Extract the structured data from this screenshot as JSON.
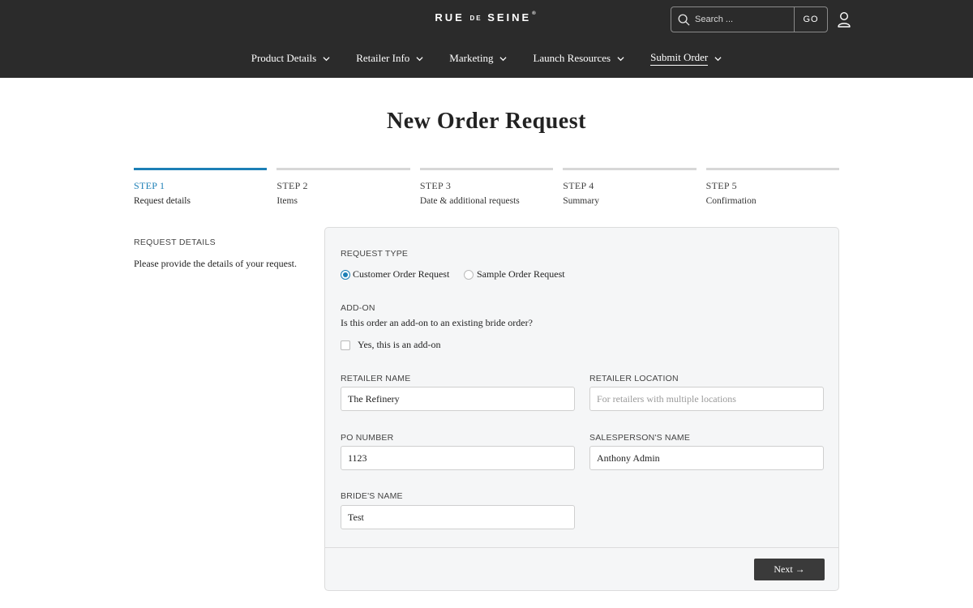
{
  "header": {
    "logo_part1": "RUE",
    "logo_part2": "DE",
    "logo_part3": "SEINE",
    "logo_mark": "®",
    "search_placeholder": "Search ...",
    "search_button": "GO"
  },
  "nav": {
    "items": [
      {
        "label": "Product Details"
      },
      {
        "label": "Retailer Info"
      },
      {
        "label": "Marketing"
      },
      {
        "label": "Launch Resources"
      },
      {
        "label": "Submit Order"
      }
    ]
  },
  "page": {
    "title": "New Order Request"
  },
  "steps": [
    {
      "num": "STEP 1",
      "desc": "Request details",
      "active": true
    },
    {
      "num": "STEP 2",
      "desc": "Items",
      "active": false
    },
    {
      "num": "STEP 3",
      "desc": "Date & additional requests",
      "active": false
    },
    {
      "num": "STEP 4",
      "desc": "Summary",
      "active": false
    },
    {
      "num": "STEP 5",
      "desc": "Confirmation",
      "active": false
    }
  ],
  "side": {
    "heading": "REQUEST DETAILS",
    "text": "Please provide the details of your request."
  },
  "form": {
    "request_type": {
      "label": "REQUEST TYPE",
      "options": [
        "Customer Order Request",
        "Sample Order Request"
      ],
      "selected": "Customer Order Request"
    },
    "addon": {
      "label": "ADD-ON",
      "question": "Is this order an add-on to an existing bride order?",
      "checkbox_label": "Yes, this is an add-on",
      "checked": false
    },
    "retailer_name": {
      "label": "RETAILER NAME",
      "value": "The Refinery"
    },
    "retailer_location": {
      "label": "RETAILER LOCATION",
      "value": "",
      "placeholder": "For retailers with multiple locations"
    },
    "po_number": {
      "label": "PO NUMBER",
      "value": "1123"
    },
    "salesperson_name": {
      "label": "SALESPERSON'S NAME",
      "value": "Anthony Admin"
    },
    "brides_name": {
      "label": "BRIDE'S NAME",
      "value": "Test"
    },
    "next_button": "Next →"
  },
  "colors": {
    "header_bg": "#2b2b2b",
    "accent": "#1c7fb6",
    "card_bg": "#f5f6f7",
    "button_bg": "#3a3a3a"
  },
  "icons": {
    "search": "search-icon",
    "user": "user-icon",
    "chevron": "chevron-down-icon"
  }
}
